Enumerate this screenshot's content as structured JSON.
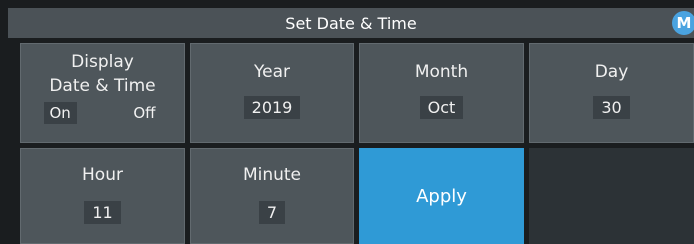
{
  "header": {
    "title": "Set Date & Time",
    "badge": "M"
  },
  "display": {
    "label_line1": "Display",
    "label_line2": "Date & Time",
    "on_label": "On",
    "off_label": "Off"
  },
  "year": {
    "label": "Year",
    "value": "2019"
  },
  "month": {
    "label": "Month",
    "value": "Oct"
  },
  "day": {
    "label": "Day",
    "value": "30"
  },
  "hour": {
    "label": "Hour",
    "value": "11"
  },
  "minute": {
    "label": "Minute",
    "value": "7"
  },
  "apply": {
    "label": "Apply"
  },
  "colors": {
    "accent": "#2f9ad6",
    "tile": "#4e565b",
    "header": "#4b5257"
  }
}
